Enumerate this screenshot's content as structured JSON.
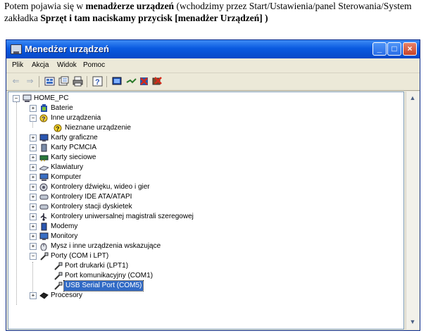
{
  "intro": {
    "part1": "Potem pojawia się w ",
    "bold1": "menadżerze urządzeń",
    "part2": "  (wchodzimy przez Start/Ustawienia/panel Sterowania/System zakładka ",
    "bold2": "Sprzęt i tam naciskamy przycisk [menadżer Urządzeń] )"
  },
  "window": {
    "title": "Menedżer urządzeń",
    "buttons": {
      "minimize": "_",
      "maximize": "□",
      "close": "×"
    }
  },
  "menu": [
    "Plik",
    "Akcja",
    "Widok",
    "Pomoc"
  ],
  "toolbar_icons": [
    "back-icon",
    "forward-icon",
    "properties-view-icon",
    "details-icon",
    "print-icon",
    "help-icon",
    "scan-hardware-icon",
    "update-driver-icon",
    "disable-icon",
    "uninstall-icon"
  ],
  "tree": {
    "root": "HOME_PC",
    "items": [
      {
        "label": "Baterie",
        "expander": "+",
        "icon": "battery-icon"
      },
      {
        "label": "Inne urządzenia",
        "expander": "−",
        "icon": "unknown-device-icon"
      },
      {
        "label": "Nieznane urządzenie",
        "expander": "",
        "icon": "question-icon",
        "child": true
      },
      {
        "label": "Karty graficzne",
        "expander": "+",
        "icon": "display-adapter-icon"
      },
      {
        "label": "Karty PCMCIA",
        "expander": "+",
        "icon": "pcmcia-icon"
      },
      {
        "label": "Karty sieciowe",
        "expander": "+",
        "icon": "network-adapter-icon"
      },
      {
        "label": "Klawiatury",
        "expander": "+",
        "icon": "keyboard-icon"
      },
      {
        "label": "Komputer",
        "expander": "+",
        "icon": "computer-icon"
      },
      {
        "label": "Kontrolery dźwięku, wideo i gier",
        "expander": "+",
        "icon": "sound-icon"
      },
      {
        "label": "Kontrolery IDE ATA/ATAPI",
        "expander": "+",
        "icon": "ide-controller-icon"
      },
      {
        "label": "Kontrolery stacji dyskietek",
        "expander": "+",
        "icon": "floppy-controller-icon"
      },
      {
        "label": "Kontrolery uniwersalnej magistrali szeregowej",
        "expander": "+",
        "icon": "usb-icon"
      },
      {
        "label": "Modemy",
        "expander": "+",
        "icon": "modem-icon"
      },
      {
        "label": "Monitory",
        "expander": "+",
        "icon": "monitor-icon"
      },
      {
        "label": "Mysz i inne urządzenia wskazujące",
        "expander": "+",
        "icon": "mouse-icon"
      },
      {
        "label": "Porty (COM i LPT)",
        "expander": "−",
        "icon": "port-icon"
      },
      {
        "label": "Port drukarki (LPT1)",
        "expander": "",
        "icon": "port-icon",
        "child": true
      },
      {
        "label": "Port komunikacyjny (COM1)",
        "expander": "",
        "icon": "port-icon",
        "child": true
      },
      {
        "label": "USB Serial Port (COM5)",
        "expander": "",
        "icon": "port-icon",
        "child": true,
        "selected": true
      },
      {
        "label": "Procesory",
        "expander": "+",
        "icon": "processor-icon"
      }
    ]
  }
}
